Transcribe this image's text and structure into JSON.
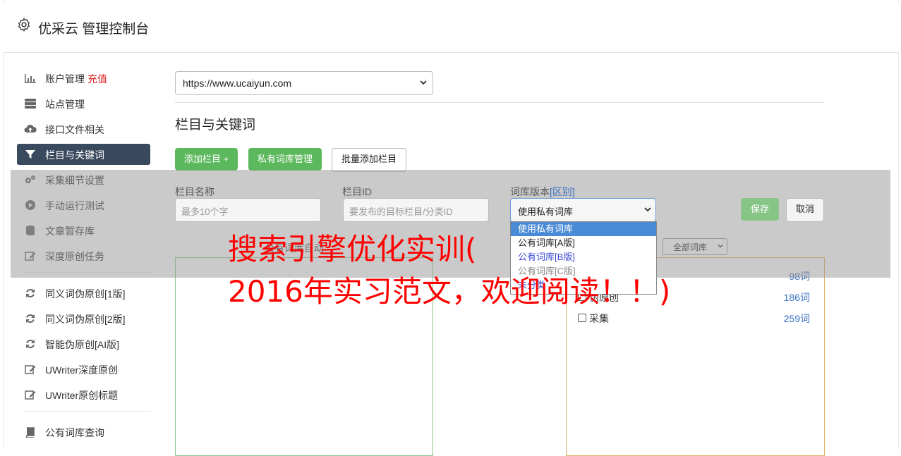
{
  "header": {
    "title": "优采云 管理控制台",
    "icon": "gear-icon"
  },
  "sidebar": {
    "items": [
      {
        "label": "账户管理",
        "badge": "充值",
        "icon": "bar-chart-icon"
      },
      {
        "label": "站点管理",
        "icon": "server-icon"
      },
      {
        "label": "接口文件相关",
        "icon": "cloud-upload-icon"
      },
      {
        "label": "栏目与关键词",
        "icon": "filter-icon",
        "active": true
      },
      {
        "label": "采集细节设置",
        "icon": "cogs-icon"
      },
      {
        "label": "手动运行测试",
        "icon": "play-circle-icon"
      },
      {
        "label": "文章暂存库",
        "icon": "database-icon"
      },
      {
        "label": "深度原创任务",
        "icon": "edit-icon"
      },
      {
        "label": "同义词伪原创[1版]",
        "icon": "refresh-icon"
      },
      {
        "label": "同义词伪原创[2版]",
        "icon": "refresh-icon"
      },
      {
        "label": "智能伪原创[AI版]",
        "icon": "refresh-icon"
      },
      {
        "label": "UWriter深度原创",
        "icon": "edit-icon"
      },
      {
        "label": "UWriter原创标题",
        "icon": "edit-icon"
      },
      {
        "label": "公有词库查询",
        "icon": "book-icon"
      }
    ]
  },
  "main": {
    "site_select": "https://www.ucaiyun.com",
    "section_title": "栏目与关键词",
    "buttons": {
      "add_column": "添加栏目 +",
      "private_lib": "私有词库管理",
      "batch_add": "批量添加栏目",
      "save": "保存",
      "cancel": "取消"
    },
    "form": {
      "col_name_label": "栏目名称",
      "col_name_placeholder": "最多10个字",
      "col_id_label": "栏目ID",
      "col_id_placeholder": "要发布的目标栏目/分类ID",
      "lib_version_label": "词库版本",
      "lib_version_link": "[区别]",
      "lib_version_value": "使用私有词库"
    },
    "dropdown_options": [
      "使用私有词库",
      "公有词库[A版]",
      "公有词库[B版]",
      "公有词库[C版]",
      "未分类"
    ],
    "behind_label": "公有词库自动",
    "all_libs": "全部词库",
    "lib_list": [
      {
        "name": "",
        "count": "98词"
      },
      {
        "name": "伪原创",
        "count": "186词"
      },
      {
        "name": "采集",
        "count": "259词"
      }
    ],
    "watermark": {
      "line1": "搜索引擎优化实训(",
      "line2": "2016年实习范文，欢迎阅读！！)"
    }
  },
  "colors": {
    "accent_green": "#5cb85c",
    "active_nav": "#3a4a5e",
    "badge_red": "#e02020",
    "link_blue": "#3a6fc4",
    "watermark_red": "#ff0000"
  }
}
